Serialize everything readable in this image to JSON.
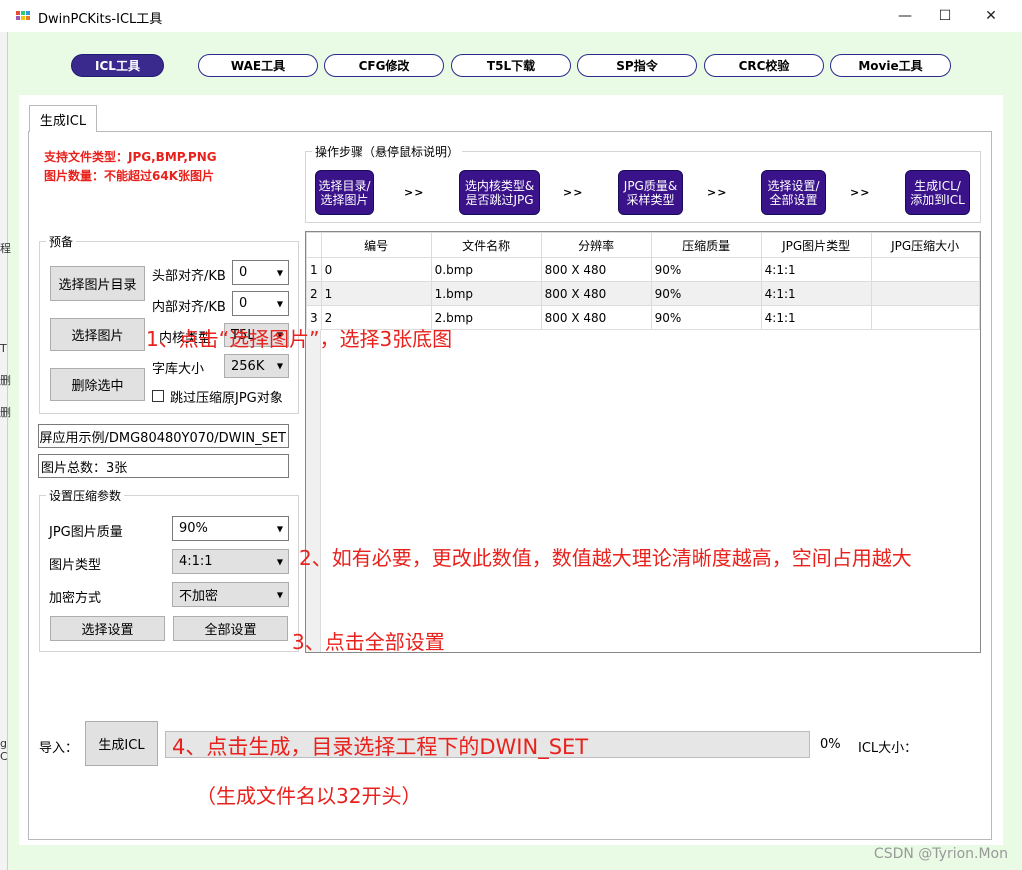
{
  "window": {
    "title": "DwinPCKits-ICL工具",
    "min_glyph": "—",
    "max_glyph": "☐",
    "close_glyph": "✕"
  },
  "left_strip": [
    "程",
    "T",
    "删",
    "删",
    "g",
    "C"
  ],
  "top_tabs": [
    {
      "label": "ICL工具",
      "active": true
    },
    {
      "label": "WAE工具",
      "active": false
    },
    {
      "label": "CFG修改",
      "active": false
    },
    {
      "label": "T5L下载",
      "active": false
    },
    {
      "label": "SP指令",
      "active": false
    },
    {
      "label": "CRC校验",
      "active": false
    },
    {
      "label": "Movie工具",
      "active": false
    }
  ],
  "tab": {
    "label": "生成ICL"
  },
  "support": {
    "types": "支持文件类型：JPG,BMP,PNG",
    "count": "图片数量：不能超过64K张图片"
  },
  "steps": {
    "legend": "操作步骤（悬停鼠标说明）",
    "items": [
      {
        "line1": "选择目录/",
        "line2": "选择图片"
      },
      {
        "line1": "选内核类型&",
        "line2": "是否跳过JPG"
      },
      {
        "line1": "JPG质量&",
        "line2": "采样类型"
      },
      {
        "line1": "选择设置/",
        "line2": "全部设置"
      },
      {
        "line1": "生成ICL/",
        "line2": "添加到ICL"
      }
    ],
    "separator": ">>"
  },
  "prepare": {
    "legend": "预备",
    "select_dir": "选择图片目录",
    "select_pics": "选择图片",
    "delete_selected": "删除选中",
    "head_align_label": "头部对齐/KB",
    "head_align_value": "0",
    "inner_align_label": "内部对齐/KB",
    "inner_align_value": "0",
    "core_type_label": "内核类型",
    "core_type_value": "T5L",
    "lib_size_label": "字库大小",
    "lib_size_value": "256K",
    "skip_jpg_label": "跳过压缩原JPG对象"
  },
  "path": {
    "value": "屏应用示例/DMG80480Y070/DWIN_SET"
  },
  "total": {
    "value": "图片总数：3张"
  },
  "compress": {
    "legend": "设置压缩参数",
    "quality_label": "JPG图片质量",
    "quality_value": "90%",
    "type_label": "图片类型",
    "type_value": "4:1:1",
    "encrypt_label": "加密方式",
    "encrypt_value": "不加密",
    "select_setting": "选择设置",
    "all_setting": "全部设置"
  },
  "grid": {
    "headers": [
      "编号",
      "文件名称",
      "分辨率",
      "压缩质量",
      "JPG图片类型",
      "JPG压缩大小"
    ],
    "rows": [
      {
        "n": "1",
        "id": "0",
        "name": "0.bmp",
        "res": "800 X 480",
        "q": "90%",
        "type": "4:1:1",
        "size": ""
      },
      {
        "n": "2",
        "id": "1",
        "name": "1.bmp",
        "res": "800 X 480",
        "q": "90%",
        "type": "4:1:1",
        "size": ""
      },
      {
        "n": "3",
        "id": "2",
        "name": "2.bmp",
        "res": "800 X 480",
        "q": "90%",
        "type": "4:1:1",
        "size": ""
      }
    ]
  },
  "bottom": {
    "import_label": "导入：",
    "generate": "生成ICL",
    "progress_percent": "0%",
    "progress_value": 0,
    "icl_size_label": "ICL大小："
  },
  "annotations": {
    "a1": "1、点击“选择图片”，选择3张底图",
    "a2": "2、如有必要，更改此数值，数值越大理论清晰度越高，空间占用越大",
    "a3": "3、点击全部设置",
    "a4": "4、点击生成，目录选择工程下的DWIN_SET",
    "a5": "（生成文件名以32开头）"
  },
  "watermark": "CSDN @Tyrion.Mon",
  "colors": {
    "accent": "#3a128a",
    "annotation": "#e8211c",
    "window_bg": "#e9fbe4"
  }
}
